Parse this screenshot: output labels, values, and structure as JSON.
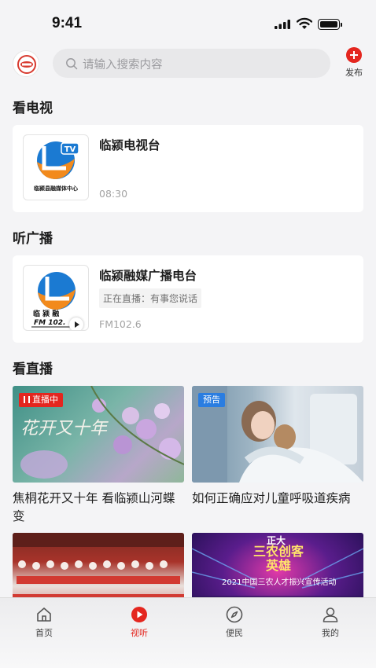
{
  "status_bar": {
    "time": "9:41"
  },
  "header": {
    "search_placeholder": "请输入搜索内容",
    "publish_label": "发布"
  },
  "sections": {
    "tv": "看电视",
    "radio": "听广播",
    "live": "看直播"
  },
  "tv_card": {
    "title": "临颍电视台",
    "time": "08:30",
    "logo_caption": "临颍县融媒体中心"
  },
  "radio_card": {
    "title": "临颍融媒广播电台",
    "now_playing": "正在直播：有事您说话",
    "frequency": "FM102.6",
    "logo_caption": "临 颍 融",
    "logo_fm": "FM 102."
  },
  "videos": [
    {
      "badge": "直播中",
      "title": "焦桐花开又十年 看临颍山河蝶变",
      "thumb_caption": "花开又十年"
    },
    {
      "badge": "预告",
      "title": "如何正确应对儿童呼吸道疾病"
    },
    {
      "badge": "",
      "title": ""
    },
    {
      "badge": "",
      "title": "",
      "thumb_caption": "三农创客英雄",
      "thumb_sub": "2021中国三农人才振兴宣传活动",
      "thumb_top": "正大"
    }
  ],
  "tabbar": [
    {
      "label": "首页",
      "icon": "home-icon"
    },
    {
      "label": "视听",
      "icon": "play-icon"
    },
    {
      "label": "便民",
      "icon": "compass-icon"
    },
    {
      "label": "我的",
      "icon": "user-icon"
    }
  ],
  "colors": {
    "accent": "#e4261f",
    "preview_badge": "#2a7de1",
    "background": "#f4f4f6"
  }
}
